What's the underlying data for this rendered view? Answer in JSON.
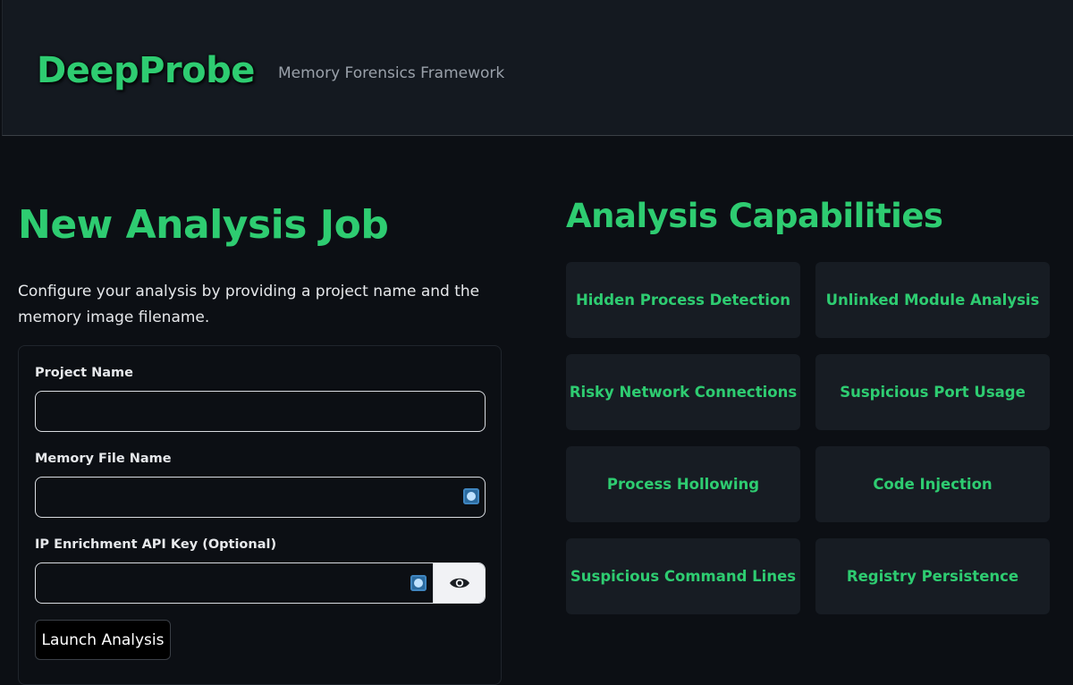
{
  "header": {
    "brand": "DeepProbe",
    "tagline": "Memory Forensics Framework"
  },
  "job": {
    "title": "New Analysis Job",
    "description": "Configure your analysis by providing a project name and the memory image filename.",
    "fields": {
      "project_name": {
        "label": "Project Name",
        "value": "",
        "placeholder": ""
      },
      "memory_file": {
        "label": "Memory File Name",
        "value": "",
        "placeholder": ""
      },
      "api_key": {
        "label": "IP Enrichment API Key (Optional)",
        "value": "",
        "placeholder": ""
      }
    },
    "launch_label": "Launch Analysis"
  },
  "capabilities": {
    "title": "Analysis Capabilities",
    "items": [
      "Hidden Process Detection",
      "Unlinked Module Analysis",
      "Risky Network Connections",
      "Suspicious Port Usage",
      "Process Hollowing",
      "Code Injection",
      "Suspicious Command Lines",
      "Registry Persistence"
    ]
  },
  "icons": {
    "autofill": "autofill-icon",
    "toggle_visibility": "eye-icon"
  },
  "colors": {
    "accent": "#2ecc71",
    "background": "#0c0f14",
    "panel": "#171c23"
  }
}
